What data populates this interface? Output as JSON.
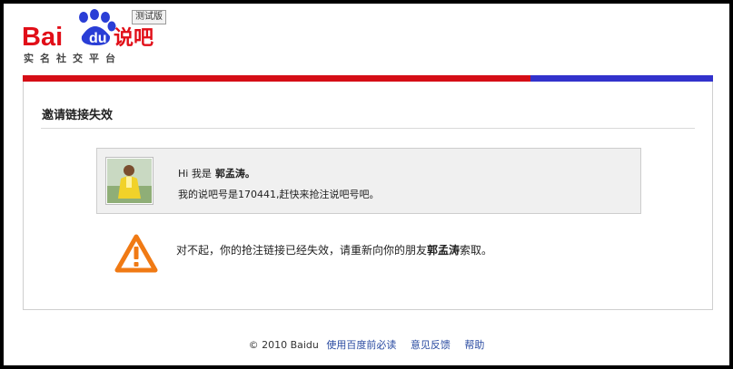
{
  "header": {
    "logo_text": "Baidu说吧",
    "beta_label": "测试版",
    "tagline": "实名社交平台"
  },
  "colors": {
    "brand_red": "#d50d16",
    "brand_blue": "#3232cc",
    "link": "#2a4ba1",
    "warning_orange": "#f07a14"
  },
  "card": {
    "title": "邀请链接失效"
  },
  "invite": {
    "greeting": "Hi 我是",
    "name": "郭孟涛。",
    "message": "我的说吧号是170441,赶快来抢注说吧号吧。",
    "avatar_icon": "user-photo"
  },
  "warning": {
    "icon": "warning-triangle-icon",
    "text_before": "对不起，你的抢注链接已经失效，请重新向你的朋友",
    "friend": "郭孟涛",
    "text_after": "索取。"
  },
  "footer": {
    "copyright": "© 2010 Baidu",
    "links": [
      "使用百度前必读",
      "意见反馈",
      "帮助"
    ]
  }
}
